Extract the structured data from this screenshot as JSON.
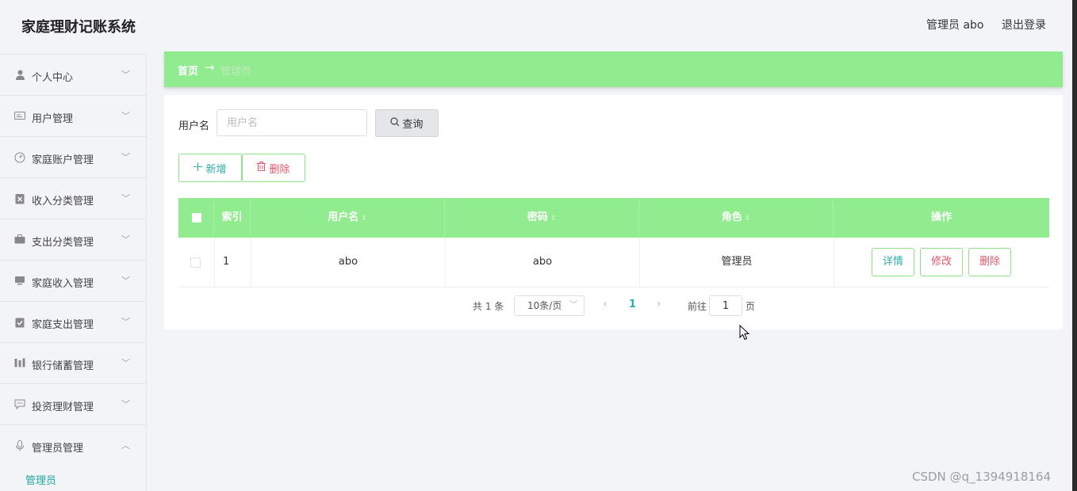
{
  "header": {
    "app_title": "家庭理财记账系统",
    "user_label": "管理员 abo",
    "logout_label": "退出登录"
  },
  "sidebar": {
    "items": [
      {
        "label": "个人中心",
        "icon": "user-icon",
        "chevron": "﹀"
      },
      {
        "label": "用户管理",
        "icon": "id-card-icon",
        "chevron": "﹀"
      },
      {
        "label": "家庭账户管理",
        "icon": "gauge-icon",
        "chevron": "﹀"
      },
      {
        "label": "收入分类管理",
        "icon": "box-icon",
        "chevron": "﹀"
      },
      {
        "label": "支出分类管理",
        "icon": "suitcase-icon",
        "chevron": "﹀"
      },
      {
        "label": "家庭收入管理",
        "icon": "monitor-icon",
        "chevron": "﹀"
      },
      {
        "label": "家庭支出管理",
        "icon": "clipboard-check-icon",
        "chevron": "﹀"
      },
      {
        "label": "银行储蓄管理",
        "icon": "bar-chart-icon",
        "chevron": "﹀"
      },
      {
        "label": "投资理财管理",
        "icon": "comment-icon",
        "chevron": "﹀"
      },
      {
        "label": "管理员管理",
        "icon": "microphone-icon",
        "chevron": "︿"
      }
    ],
    "subitem": "管理员"
  },
  "breadcrumb": {
    "home": "首页",
    "arrow": "→",
    "current": "管理员"
  },
  "search": {
    "label": "用户名",
    "placeholder": "用户名",
    "query_label": "查询"
  },
  "actions": {
    "add_label": "新增",
    "delete_label": "删除"
  },
  "table": {
    "columns": [
      "索引",
      "用户名",
      "密码",
      "角色",
      "操作"
    ],
    "rows": [
      {
        "index": "1",
        "username": "abo",
        "password": "abo",
        "role": "管理员"
      }
    ],
    "row_actions": {
      "detail": "详情",
      "edit": "修改",
      "delete": "删除"
    }
  },
  "pagination": {
    "total": "共 1 条",
    "page_size": "10条/页",
    "current_page": "1",
    "goto_label": "前往",
    "goto_value": "1",
    "page_suffix": "页"
  },
  "watermark": "CSDN @q_1394918164",
  "colors": {
    "accent_green": "#90ec8e",
    "teal_text": "#2bb0a8",
    "danger_text": "#e3566a",
    "background": "#f3f4f8"
  }
}
